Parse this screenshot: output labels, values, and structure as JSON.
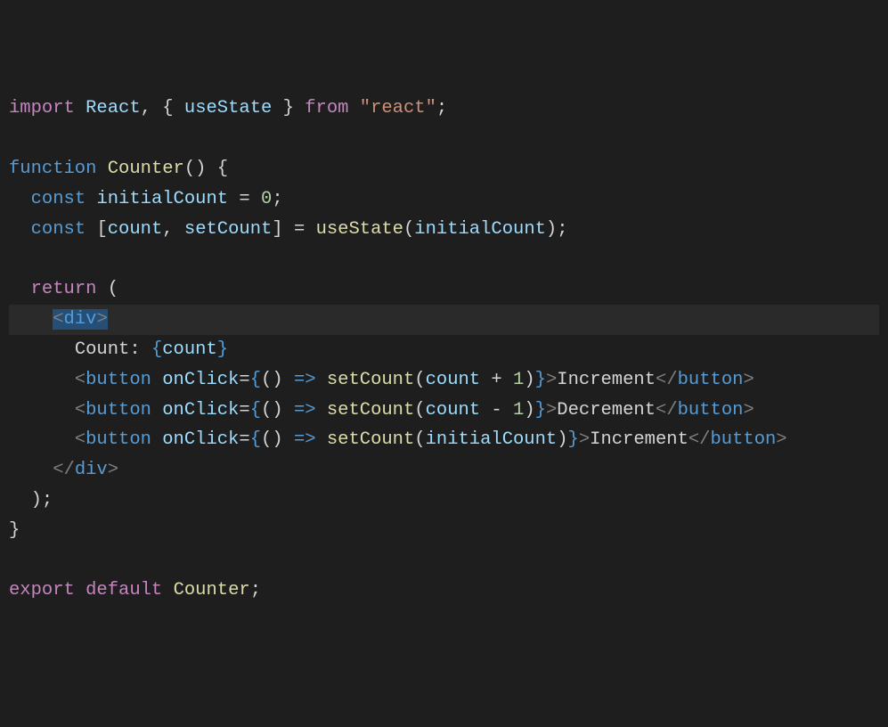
{
  "code": {
    "l1_import": "import",
    "l1_react": "React",
    "l1_comma": ",",
    "l1_ob": "{",
    "l1_usestate": "useState",
    "l1_cb": "}",
    "l1_from": "from",
    "l1_reactstr": "\"react\"",
    "l1_semi": ";",
    "l3_function": "function",
    "l3_counter": "Counter",
    "l3_op": "(",
    "l3_cp": ")",
    "l3_ob": "{",
    "l4_const": "const",
    "l4_initialCount": "initialCount",
    "l4_eq": "=",
    "l4_zero": "0",
    "l4_semi": ";",
    "l5_const": "const",
    "l5_osb": "[",
    "l5_count": "count",
    "l5_comma": ",",
    "l5_setCount": "setCount",
    "l5_csb": "]",
    "l5_eq": "=",
    "l5_useState": "useState",
    "l5_op": "(",
    "l5_initialCount": "initialCount",
    "l5_cp": ")",
    "l5_semi": ";",
    "l7_return": "return",
    "l7_op": "(",
    "l8_lt": "<",
    "l8_div": "div",
    "l8_gt": ">",
    "l9_counttext": "Count: ",
    "l9_ob": "{",
    "l9_count": "count",
    "l9_cb": "}",
    "l10_lt": "<",
    "l10_button": "button",
    "l10_onclick": "onClick",
    "l10_eq": "=",
    "l10_ob": "{",
    "l10_op": "(",
    "l10_cp": ")",
    "l10_arrow": "=>",
    "l10_setCount": "setCount",
    "l10_op2": "(",
    "l10_count": "count",
    "l10_plus": "+",
    "l10_one": "1",
    "l10_cp2": ")",
    "l10_cb": "}",
    "l10_gt": ">",
    "l10_text": "Increment",
    "l10_clt": "</",
    "l10_cbutton": "button",
    "l10_cgt": ">",
    "l11_lt": "<",
    "l11_button": "button",
    "l11_onclick": "onClick",
    "l11_eq": "=",
    "l11_ob": "{",
    "l11_op": "(",
    "l11_cp": ")",
    "l11_arrow": "=>",
    "l11_setCount": "setCount",
    "l11_op2": "(",
    "l11_count": "count",
    "l11_minus": "-",
    "l11_one": "1",
    "l11_cp2": ")",
    "l11_cb": "}",
    "l11_gt": ">",
    "l11_text": "Decrement",
    "l11_clt": "</",
    "l11_cbutton": "button",
    "l11_cgt": ">",
    "l12_lt": "<",
    "l12_button": "button",
    "l12_onclick": "onClick",
    "l12_eq": "=",
    "l12_ob": "{",
    "l12_op": "(",
    "l12_cp": ")",
    "l12_arrow": "=>",
    "l12_setCount": "setCount",
    "l12_op2": "(",
    "l12_initialCount": "initialCount",
    "l12_cp2": ")",
    "l12_cb": "}",
    "l12_gt": ">",
    "l12_text": "Increment",
    "l12_clt": "</",
    "l12_cbutton": "button",
    "l12_cgt": ">",
    "l13_clt": "</",
    "l13_div": "div",
    "l13_cgt": ">",
    "l14_cp": ")",
    "l14_semi": ";",
    "l15_cb": "}",
    "l17_export": "export",
    "l17_default": "default",
    "l17_counter": "Counter",
    "l17_semi": ";"
  }
}
